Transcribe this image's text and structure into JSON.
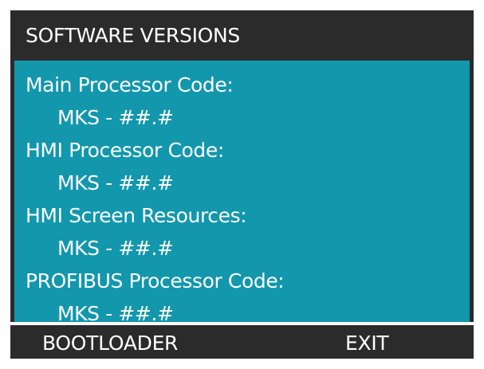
{
  "screen": {
    "title": "SOFTWARE VERSIONS"
  },
  "versions": [
    {
      "label": "Main Processor Code:",
      "value": "MKS - ##.#"
    },
    {
      "label": "HMI Processor Code:",
      "value": "MKS - ##.#"
    },
    {
      "label": "HMI Screen Resources:",
      "value": "MKS - ##.#"
    },
    {
      "label": "PROFIBUS Processor Code:",
      "value": "MKS - ##.#"
    }
  ],
  "softkeys": {
    "left_label": "BOOTLOADER",
    "right_label": "EXIT"
  },
  "colors": {
    "frame": "#2b2b2b",
    "content_background": "#1297ad",
    "text": "#ffffff",
    "separator": "#ffffff"
  }
}
